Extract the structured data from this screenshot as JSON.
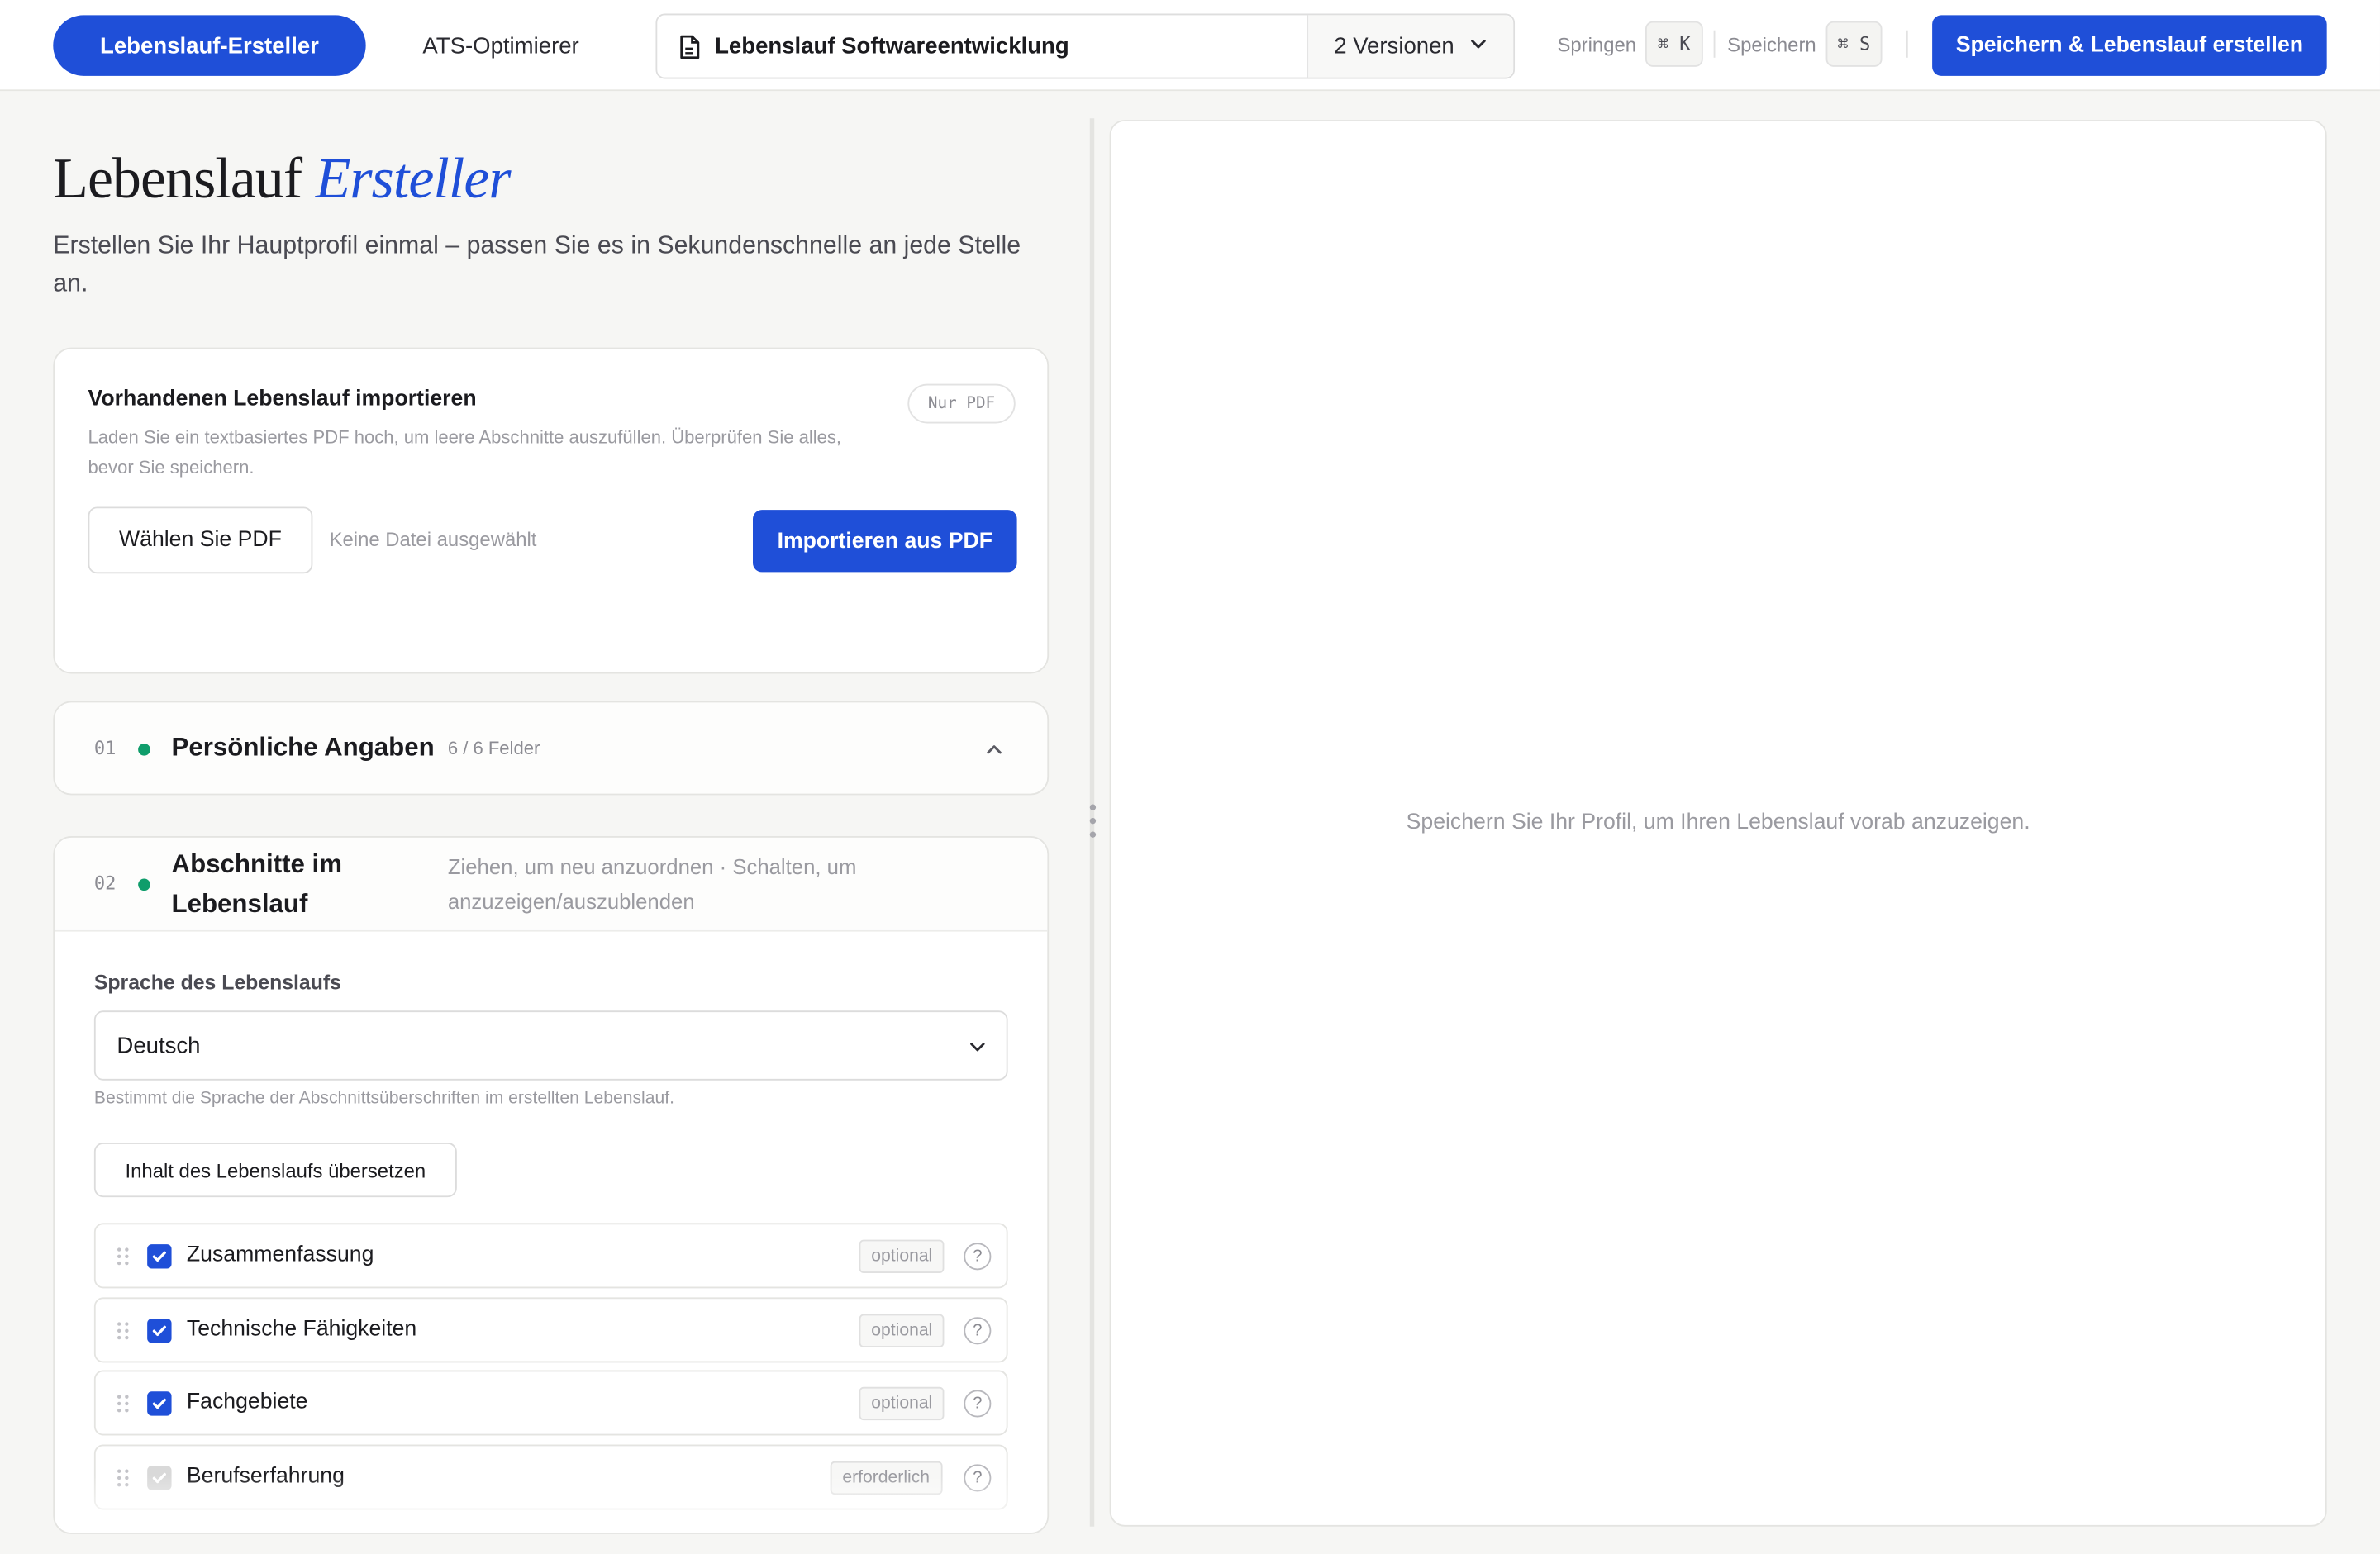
{
  "topbar": {
    "tabs": [
      {
        "label": "Lebenslauf-Ersteller",
        "active": true
      },
      {
        "label": "ATS-Optimierer",
        "active": false
      }
    ],
    "document": {
      "name": "Lebenslauf Softwareentwicklung",
      "icon": "document-icon"
    },
    "versions_label": "2 Versionen",
    "shortcuts": [
      {
        "label": "Springen",
        "key": "⌘ K"
      },
      {
        "label": "Speichern",
        "key": "⌘ S"
      }
    ],
    "save_create_label": "Speichern & Lebenslauf erstellen"
  },
  "page": {
    "title_main": "Lebenslauf",
    "title_accent": "Ersteller",
    "subtitle": "Erstellen Sie Ihr Hauptprofil einmal – passen Sie es in Sekundenschnelle an jede Stelle an."
  },
  "import": {
    "title": "Vorhandenen Lebenslauf importieren",
    "description": "Laden Sie ein textbasiertes PDF hoch, um leere Abschnitte auszufüllen. Überprüfen Sie alles, bevor Sie speichern.",
    "badge": "Nur PDF",
    "choose_label": "Wählen Sie PDF",
    "no_file": "Keine Datei ausgewählt",
    "import_label": "Importieren aus PDF"
  },
  "sections": [
    {
      "num": "01",
      "title": "Persönliche Angaben",
      "meta": "6 / 6 Felder",
      "status_color": "#0f9d6b"
    },
    {
      "num": "02",
      "title": "Abschnitte im Lebenslauf",
      "meta": "Ziehen, um neu anzuordnen · Schalten, um anzuzeigen/auszublenden",
      "status_color": "#0f9d6b"
    }
  ],
  "language": {
    "label": "Sprache des Lebenslaufs",
    "selected": "Deutsch",
    "help": "Bestimmt die Sprache der Abschnittsüberschriften im erstellten Lebenslauf.",
    "translate_label": "Inhalt des Lebenslaufs übersetzen"
  },
  "resume_sections": [
    {
      "label": "Zusammenfassung",
      "checked": true,
      "disabled": false,
      "badge": "optional"
    },
    {
      "label": "Technische Fähigkeiten",
      "checked": true,
      "disabled": false,
      "badge": "optional"
    },
    {
      "label": "Fachgebiete",
      "checked": true,
      "disabled": false,
      "badge": "optional"
    },
    {
      "label": "Berufserfahrung",
      "checked": true,
      "disabled": true,
      "badge": "erforderlich"
    }
  ],
  "help_glyph": "?",
  "preview": {
    "message": "Speichern Sie Ihr Profil, um Ihren Lebenslauf vorab anzuzeigen."
  },
  "colors": {
    "accent": "#1f4fd8",
    "status_done": "#0f9d6b",
    "background": "#f6f6f4"
  }
}
